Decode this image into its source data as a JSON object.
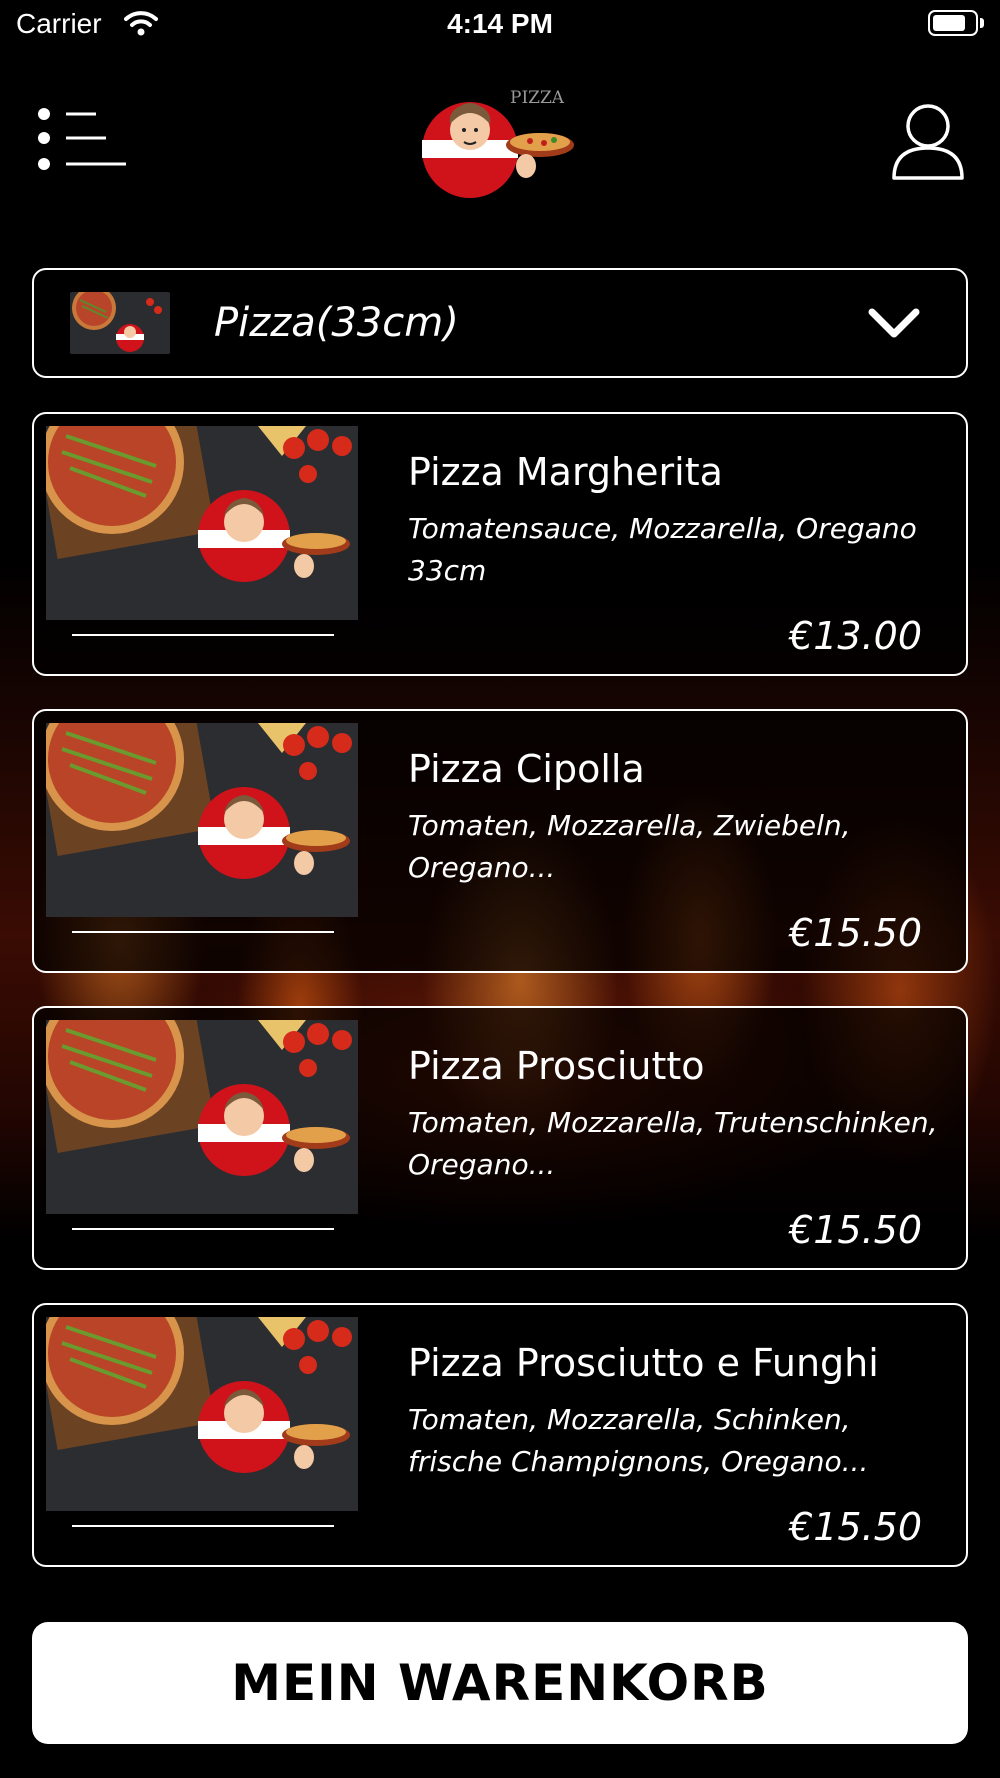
{
  "status_bar": {
    "carrier": "Carrier",
    "time": "4:14 PM"
  },
  "header": {
    "logo_text": "PIZZA",
    "icons": [
      "menu-icon",
      "logo",
      "user-icon"
    ]
  },
  "category": {
    "label": "Pizza(33cm)",
    "icon": "chevron-down-icon"
  },
  "products": [
    {
      "name": "Pizza Margherita",
      "description": "Tomatensauce, Mozzarella, Oregano 33cm",
      "price": "€13.00"
    },
    {
      "name": "Pizza Cipolla",
      "description": "Tomaten, Mozzarella, Zwiebeln, Oregano...",
      "price": "€15.50"
    },
    {
      "name": "Pizza Prosciutto",
      "description": "Tomaten, Mozzarella, Trutenschinken, Oregano...",
      "price": "€15.50"
    },
    {
      "name": "Pizza Prosciutto e Funghi",
      "description": "Tomaten, Mozzarella, Schinken, frische Champignons, Oregano...",
      "price": "€15.50"
    }
  ],
  "cart": {
    "label": "MEIN WARENKORB"
  },
  "colors": {
    "background": "#000000",
    "foreground": "#ffffff",
    "logo_red": "#d0121b"
  }
}
